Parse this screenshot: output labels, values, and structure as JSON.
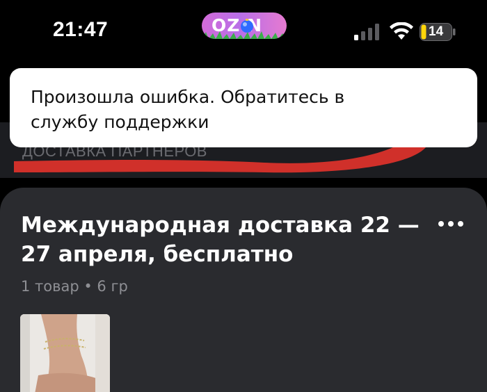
{
  "status_bar": {
    "time": "21:47",
    "app_pill_text": "OZ N",
    "battery_level": "14",
    "icons": [
      "cellular-signal-icon",
      "wifi-icon",
      "battery-icon"
    ]
  },
  "toast": {
    "message": "Произошла ошибка. Обратитесь в службу поддержки"
  },
  "section": {
    "heading_obscured": "ДОСТАВКА ПАРТНЕРОВ"
  },
  "card": {
    "title": "Международная доставка 22 — 27 апреля, бесплатно",
    "meta": "1 товар • 6 гр",
    "more_icon": "more-horizontal-icon"
  },
  "colors": {
    "background": "#000000",
    "card": "#2a2b2f",
    "toast": "#ffffff",
    "scribble": "#e0322b",
    "ozon_pill": "#c06ee0"
  }
}
